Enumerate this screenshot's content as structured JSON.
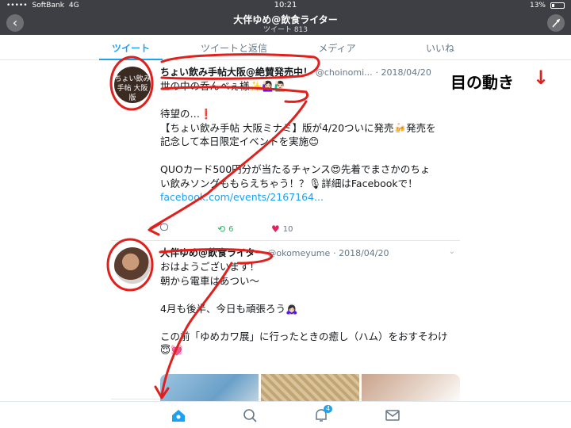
{
  "status": {
    "carrier": "SoftBank",
    "network": "4G",
    "time": "10:21",
    "battery": "13%"
  },
  "nav": {
    "title": "大伴ゆめ@飲食ライター",
    "subtitle": "ツイート 813"
  },
  "tabs": [
    {
      "label": "ツイート"
    },
    {
      "label": "ツイートと返信"
    },
    {
      "label": "メディア"
    },
    {
      "label": "いいね"
    }
  ],
  "tweets": [
    {
      "avatar_text": "ちょい飲み手帖 大阪版",
      "name": "ちょい飲み手帖大阪@絶賛発売中！",
      "handle": "@choinomi...",
      "date": "· 2018/04/20",
      "lines": [
        "世の中の呑んべぇ様✨🙋🏻‍♀️🙋🏻‍♂️",
        "",
        "待望の…❗️",
        "【ちょい飲み手帖 大阪ミナミ】版が4/20ついに発売🍻発売を",
        "記念して本日限定イベントを実施😊",
        "",
        "QUOカード500円分が当たるチャンス😍先着でまさかのちょ",
        "い飲みソングももらえちゃう！？🎙詳細はFacebookで！"
      ],
      "link": "facebook.com/events/2167164...",
      "retweets": "6",
      "likes": "10"
    },
    {
      "name": "大伴ゆめ@飲食ライター",
      "handle": "@okomeyume",
      "date": "· 2018/04/20",
      "lines": [
        "おはようございます！",
        "朝から電車はあつい〜",
        "",
        "4月も後半、今日も頑張ろう🙇🏻‍♀️",
        "",
        "この前「ゆめカワ展」に行ったときの癒し（ハム）をおすそわけ",
        "😇💓"
      ]
    }
  ],
  "annotation": {
    "label": "目の動き",
    "arrow": "↓",
    "color": "#e0201c"
  },
  "bottom": {
    "notification_badge": "4"
  },
  "colors": {
    "accent": "#1da1f2",
    "retweet": "#17bf63",
    "like": "#e0245e",
    "annotation": "#e0201c"
  }
}
